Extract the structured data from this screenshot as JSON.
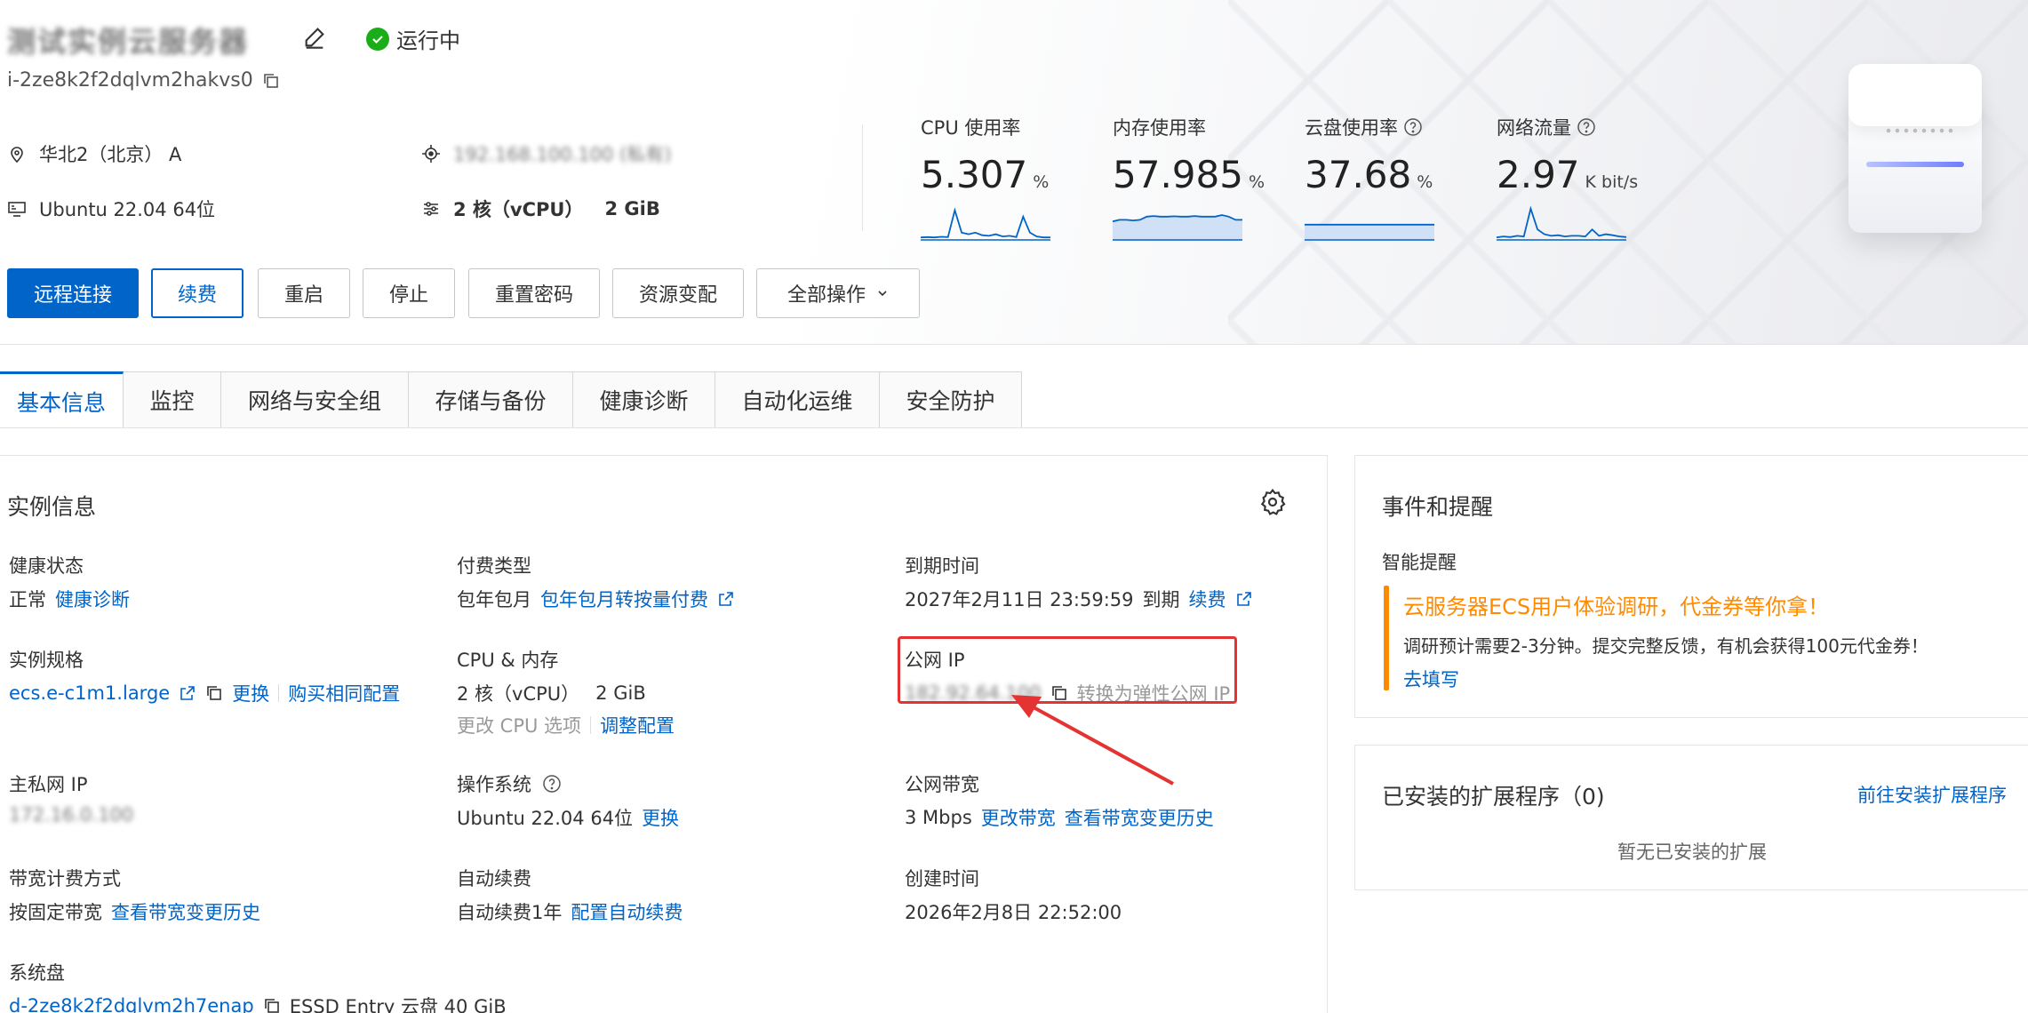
{
  "header": {
    "instance_name_blurred": "测试实例云服务器",
    "status": "运行中",
    "instance_id": "i-2ze8k2f2dqlvm2hakvs0",
    "region": "华北2（北京） A",
    "ip_blurred": "192.168.100.100 (私有)",
    "os": "Ubuntu 22.04 64位",
    "spec_cpu": "2 核（vCPU）",
    "spec_mem": "2 GiB"
  },
  "metrics": [
    {
      "label": "CPU 使用率",
      "value": "5.307",
      "unit": "%",
      "help": false,
      "spark": [
        0.05,
        0.06,
        0.05,
        0.07,
        0.06,
        0.9,
        0.2,
        0.15,
        0.2,
        0.12,
        0.1,
        0.15,
        0.08,
        0.1,
        0.06,
        0.7,
        0.2,
        0.08,
        0.05,
        0.05
      ],
      "fill": false
    },
    {
      "label": "内存使用率",
      "value": "57.985",
      "unit": "%",
      "help": false,
      "spark": [
        0.55,
        0.6,
        0.6,
        0.58,
        0.6,
        0.7,
        0.72,
        0.7,
        0.7,
        0.71,
        0.7,
        0.7,
        0.72,
        0.7,
        0.7,
        0.7,
        0.75,
        0.7,
        0.6,
        0.6
      ],
      "fill": true
    },
    {
      "label": "云盘使用率",
      "value": "37.68",
      "unit": "%",
      "help": true,
      "spark": [
        0.45,
        0.45,
        0.45,
        0.45,
        0.45,
        0.45,
        0.45,
        0.45,
        0.45,
        0.45,
        0.45,
        0.45,
        0.45,
        0.45,
        0.45,
        0.45,
        0.45,
        0.45,
        0.45,
        0.45
      ],
      "fill": true
    },
    {
      "label": "网络流量",
      "value": "2.97",
      "unit": "K bit/s",
      "help": true,
      "spark": [
        0.05,
        0.08,
        0.06,
        0.1,
        0.08,
        0.95,
        0.3,
        0.15,
        0.1,
        0.12,
        0.08,
        0.1,
        0.1,
        0.08,
        0.3,
        0.1,
        0.15,
        0.12,
        0.08,
        0.06
      ],
      "fill": false
    }
  ],
  "actions": {
    "remote": "远程连接",
    "renew": "续费",
    "restart": "重启",
    "stop": "停止",
    "reset_pwd": "重置密码",
    "change_spec": "资源变配",
    "all_ops": "全部操作"
  },
  "tabs": [
    "基本信息",
    "监控",
    "网络与安全组",
    "存储与备份",
    "健康诊断",
    "自动化运维",
    "安全防护"
  ],
  "instance_info": {
    "title": "实例信息",
    "health_label": "健康状态",
    "health_value": "正常",
    "health_link": "健康诊断",
    "pay_label": "付费类型",
    "pay_value": "包年包月",
    "pay_link": "包年包月转按量付费",
    "expire_label": "到期时间",
    "expire_value": "2027年2月11日 23:59:59",
    "expire_suffix": "到期",
    "expire_link": "续费",
    "spec_label": "实例规格",
    "spec_value": "ecs.e-c1m1.large",
    "spec_change": "更换",
    "spec_buy": "购买相同配置",
    "cpumem_label": "CPU & 内存",
    "cpu_value": "2 核（vCPU）",
    "mem_value": "2 GiB",
    "cpu_option": "更改 CPU 选项",
    "cpu_adjust": "调整配置",
    "public_ip_label": "公网 IP",
    "public_ip_blurred": "182.92.64.100",
    "public_ip_convert": "转换为弹性公网 IP",
    "private_ip_label": "主私网 IP",
    "private_ip_blurred": "172.16.0.100",
    "os_label": "操作系统",
    "os_value": "Ubuntu 22.04 64位",
    "os_change": "更换",
    "bandwidth_label": "公网带宽",
    "bandwidth_value": "3 Mbps",
    "bandwidth_change": "更改带宽",
    "bandwidth_history": "查看带宽变更历史",
    "bw_billing_label": "带宽计费方式",
    "bw_billing_value": "按固定带宽",
    "bw_billing_link": "查看带宽变更历史",
    "autorenew_label": "自动续费",
    "autorenew_value": "自动续费1年",
    "autorenew_link": "配置自动续费",
    "created_label": "创建时间",
    "created_value": "2026年2月8日 22:52:00",
    "sysdisk_label": "系统盘",
    "sysdisk_id": "d-2ze8k2f2dqlvm2h7enap",
    "sysdisk_value": "ESSD Entry 云盘  40 GiB"
  },
  "events": {
    "title": "事件和提醒",
    "smart_label": "智能提醒",
    "notice_title": "云服务器ECS用户体验调研，代金券等你拿！",
    "notice_body": "调研预计需要2-3分钟。提交完整反馈，有机会获得100元代金券！",
    "notice_link": "去填写"
  },
  "extensions": {
    "title": "已安装的扩展程序（0)",
    "link": "前往安装扩展程序",
    "empty": "暂无已安装的扩展"
  },
  "colors": {
    "primary": "#0064c8",
    "running": "#1aad19",
    "warning": "#ff8a00",
    "annotation": "#e53333"
  }
}
